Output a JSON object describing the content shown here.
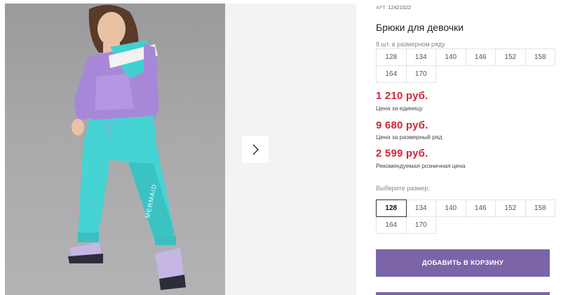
{
  "product": {
    "art_label": "АРТ.",
    "art_code": "12421022",
    "title": "Брюки для девочки"
  },
  "size_row": {
    "hint": "8 шт. в размерном ряду",
    "sizes": [
      "128",
      "134",
      "140",
      "146",
      "152",
      "158",
      "164",
      "170"
    ]
  },
  "prices": [
    {
      "value": "1 210 руб.",
      "label": "Цена за единицу"
    },
    {
      "value": "9 680 руб.",
      "label": "Цена за размерный ряд"
    },
    {
      "value": "2 599 руб.",
      "label": "Рекомендуемая розничная цена"
    }
  ],
  "size_select": {
    "hint": "Выберите размер:",
    "sizes": [
      "128",
      "134",
      "140",
      "146",
      "152",
      "158",
      "164",
      "170"
    ],
    "selected": "128"
  },
  "cart": {
    "add_label": "ДОБАВИТЬ В КОРЗИНУ"
  },
  "icons": {
    "next": "chevron-right-icon"
  },
  "colors": {
    "accent": "#7b65a8",
    "price": "#d3263a"
  }
}
